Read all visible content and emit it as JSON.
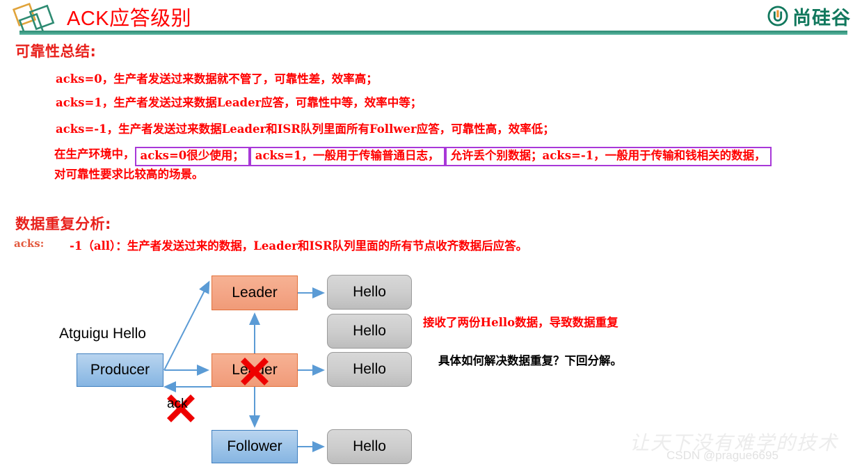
{
  "header": {
    "title": "ACK应答级别",
    "brand_text": "尚硅谷",
    "logo_icon": "diamonds-logo-icon",
    "brand_icon": "atguigu-u-mark-icon"
  },
  "section1": {
    "heading": "可靠性总结:",
    "lines": [
      "acks=0，生产者发送过来数据就不管了，可靠性差，效率高；",
      "acks=1，生产者发送过来数据Leader应答，可靠性中等，效率中等；",
      "acks=-1，生产者发送过来数据Leader和ISR队列里面所有Follwer应答，可靠性高，效率低；"
    ],
    "line4": {
      "pre": "在生产环境中，",
      "box1": "acks=0很少使用；",
      "box2": "acks=1，一般用于传输普通日志，",
      "box3": "允许丢个别数据；acks=-1，一般用于传输和钱相关的数据，",
      "tail": "对可靠性要求比较高的场景。"
    },
    "box_border_color": "#a838d8"
  },
  "section2": {
    "heading": "数据重复分析:",
    "acks_label": "acks:",
    "acks_body": "-1（all）：生产者发送过来的数据，Leader和ISR队列里面的所有节点收齐数据后应答。"
  },
  "diagram": {
    "caption": "Atguigu Hello",
    "ack_label": "ack",
    "nodes": {
      "producer": "Producer",
      "leader_top": "Leader",
      "leader_mid": "Leader",
      "follower": "Follower",
      "hello1": "Hello",
      "hello2": "Hello",
      "hello3": "Hello",
      "hello4": "Hello"
    },
    "colors": {
      "producer_fill": "#9cc3e8",
      "leader_fill": "#f4a687",
      "hello_fill": "#cccccc",
      "arrow": "#5b9bd5",
      "cross": "#ee0000"
    }
  },
  "notes": {
    "red": "接收了两份Hello数据，导致数据重复",
    "black": "具体如何解决数据重复？下回分解。"
  },
  "watermark": {
    "slogan": "让天下没有难学的技术",
    "csdn": "CSDN @prague6695"
  }
}
